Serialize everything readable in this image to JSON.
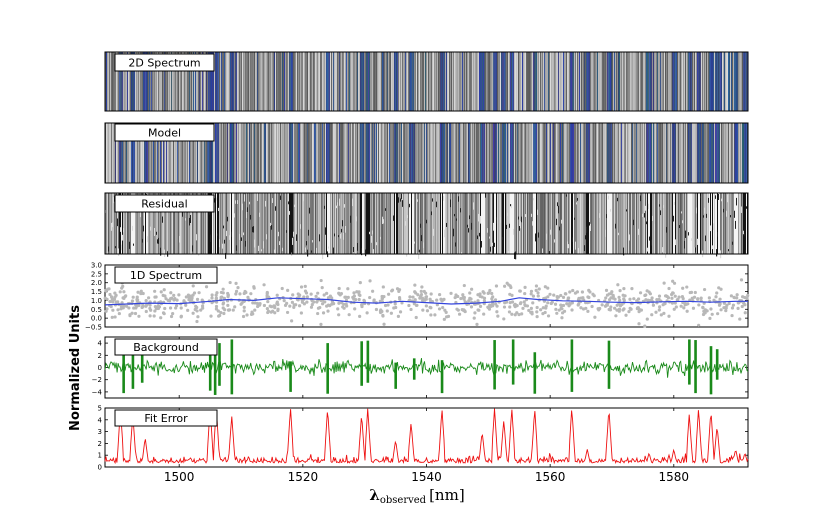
{
  "chart_data": {
    "type": "line",
    "x_range": [
      1488,
      1592
    ],
    "xticks": [
      1500,
      1520,
      1540,
      1560,
      1580
    ],
    "xlabel": {
      "main": "λ",
      "sub": "observed",
      "unit": "[nm]"
    },
    "ylabel": "Normalized Units",
    "image_panels": [
      {
        "label": "2D Spectrum",
        "colormap": "grey-blue"
      },
      {
        "label": "Model",
        "colormap": "grey-blue"
      },
      {
        "label": "Residual",
        "colormap": "grey"
      }
    ],
    "spectrum_panel": {
      "label": "1D Spectrum",
      "ylim": [
        -0.5,
        3.0
      ],
      "yticks": [
        "3.0",
        "2.5",
        "2.0",
        "1.5",
        "1.0",
        "0.5",
        "0.0",
        "−0.5"
      ],
      "series": [
        {
          "kind": "scatter",
          "color": "#b8b8b8",
          "points_approx_mean": 0.9,
          "spread": 0.45
        },
        {
          "kind": "line",
          "color": "#3344dd",
          "x": [
            1488,
            1495,
            1500,
            1505,
            1508,
            1512,
            1516,
            1520,
            1524,
            1528,
            1532,
            1536,
            1540,
            1544,
            1548,
            1552,
            1555,
            1558,
            1562,
            1566,
            1570,
            1574,
            1578,
            1582,
            1586,
            1590,
            1592
          ],
          "values": [
            0.75,
            0.85,
            0.82,
            0.95,
            1.05,
            1.0,
            1.15,
            1.1,
            1.05,
            0.9,
            0.85,
            0.95,
            0.88,
            0.8,
            0.85,
            0.95,
            1.15,
            1.05,
            0.98,
            0.95,
            0.9,
            0.88,
            0.92,
            0.95,
            0.9,
            0.95,
            0.95
          ]
        }
      ]
    },
    "background_panel": {
      "label": "Background",
      "ylim": [
        -5,
        5
      ],
      "yticks": [
        "4",
        "2",
        "0",
        "−2",
        "−4"
      ],
      "color": "#1a8a1a",
      "spikes": [
        {
          "x": 1491,
          "min": -4.2,
          "max": 4.5
        },
        {
          "x": 1492.5,
          "min": -3.5,
          "max": 4.6
        },
        {
          "x": 1494,
          "min": -2.5,
          "max": 3.0
        },
        {
          "x": 1505,
          "min": -3.8,
          "max": 4.4
        },
        {
          "x": 1505.8,
          "min": -4.5,
          "max": 4.6
        },
        {
          "x": 1506.5,
          "min": -3.0,
          "max": 4.0
        },
        {
          "x": 1508.5,
          "min": -4.4,
          "max": 4.6
        },
        {
          "x": 1518,
          "min": -4.0,
          "max": 1.0
        },
        {
          "x": 1524,
          "min": -4.3,
          "max": 4.0
        },
        {
          "x": 1529.5,
          "min": -3.0,
          "max": 4.3
        },
        {
          "x": 1530.5,
          "min": -2.5,
          "max": 4.4
        },
        {
          "x": 1535,
          "min": -3.5,
          "max": 0.8
        },
        {
          "x": 1538,
          "min": -2.0,
          "max": 1.5
        },
        {
          "x": 1542.5,
          "min": -4.2,
          "max": 1.2
        },
        {
          "x": 1551,
          "min": -3.6,
          "max": 4.5
        },
        {
          "x": 1554,
          "min": -2.8,
          "max": 4.6
        },
        {
          "x": 1557.5,
          "min": -4.3,
          "max": 2.5
        },
        {
          "x": 1563.5,
          "min": -4.0,
          "max": 4.6
        },
        {
          "x": 1569.5,
          "min": -3.5,
          "max": 4.4
        },
        {
          "x": 1582.5,
          "min": -2.8,
          "max": 4.6
        },
        {
          "x": 1583.5,
          "min": -4.2,
          "max": 4.5
        },
        {
          "x": 1586,
          "min": -4.4,
          "max": 3.5
        },
        {
          "x": 1587,
          "min": -2.0,
          "max": 3.0
        }
      ]
    },
    "fit_error_panel": {
      "label": "Fit Error",
      "ylim": [
        0,
        5
      ],
      "yticks": [
        "5",
        "4",
        "3",
        "2",
        "1",
        "0"
      ],
      "color": "#ee1111",
      "peaks": [
        {
          "x": 1490.5,
          "h": 5
        },
        {
          "x": 1492.5,
          "h": 4.4
        },
        {
          "x": 1494.5,
          "h": 2.5
        },
        {
          "x": 1505,
          "h": 5
        },
        {
          "x": 1506,
          "h": 5
        },
        {
          "x": 1508.5,
          "h": 4.3
        },
        {
          "x": 1518,
          "h": 5
        },
        {
          "x": 1524,
          "h": 5
        },
        {
          "x": 1529.5,
          "h": 4.5
        },
        {
          "x": 1530.5,
          "h": 5
        },
        {
          "x": 1535,
          "h": 2.3
        },
        {
          "x": 1537.5,
          "h": 3.8
        },
        {
          "x": 1542.5,
          "h": 5
        },
        {
          "x": 1549,
          "h": 3.0
        },
        {
          "x": 1551,
          "h": 5
        },
        {
          "x": 1552.5,
          "h": 4.0
        },
        {
          "x": 1553.8,
          "h": 5
        },
        {
          "x": 1557.5,
          "h": 5
        },
        {
          "x": 1563.5,
          "h": 5
        },
        {
          "x": 1566,
          "h": 1.5
        },
        {
          "x": 1569.5,
          "h": 5
        },
        {
          "x": 1576,
          "h": 1.2
        },
        {
          "x": 1580,
          "h": 1.5
        },
        {
          "x": 1582.5,
          "h": 4.5
        },
        {
          "x": 1584,
          "h": 5
        },
        {
          "x": 1586,
          "h": 4.8
        },
        {
          "x": 1587,
          "h": 3.5
        },
        {
          "x": 1590,
          "h": 1.5
        },
        {
          "x": 1591.5,
          "h": 1.2
        }
      ]
    }
  }
}
